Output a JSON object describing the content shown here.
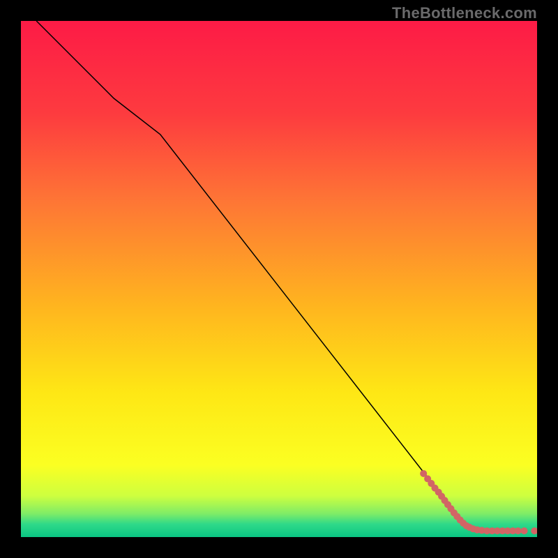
{
  "attribution": "TheBottleneck.com",
  "chart_data": {
    "type": "line",
    "title": "",
    "xlabel": "",
    "ylabel": "",
    "xlim": [
      0,
      100
    ],
    "ylim": [
      0,
      100
    ],
    "grid": false,
    "legend": false,
    "background_gradient_stops": [
      {
        "offset": 0.0,
        "color": "#fd1b46"
      },
      {
        "offset": 0.18,
        "color": "#fd3b3f"
      },
      {
        "offset": 0.35,
        "color": "#fe7635"
      },
      {
        "offset": 0.55,
        "color": "#ffb41f"
      },
      {
        "offset": 0.72,
        "color": "#fee715"
      },
      {
        "offset": 0.86,
        "color": "#fbff22"
      },
      {
        "offset": 0.92,
        "color": "#ceff3f"
      },
      {
        "offset": 0.955,
        "color": "#7eec67"
      },
      {
        "offset": 0.975,
        "color": "#2fd989"
      },
      {
        "offset": 1.0,
        "color": "#0ac683"
      }
    ],
    "series": [
      {
        "name": "curve",
        "type": "line",
        "color": "#000000",
        "width": 1.5,
        "points": [
          {
            "x": 3.0,
            "y": 100.0
          },
          {
            "x": 18.0,
            "y": 85.0
          },
          {
            "x": 27.0,
            "y": 78.0
          },
          {
            "x": 80.0,
            "y": 10.0
          },
          {
            "x": 84.0,
            "y": 4.5
          },
          {
            "x": 87.0,
            "y": 2.0
          }
        ]
      },
      {
        "name": "dots",
        "type": "scatter",
        "color": "#d16565",
        "radius": 5,
        "points": [
          {
            "x": 78.0,
            "y": 12.3
          },
          {
            "x": 78.8,
            "y": 11.3
          },
          {
            "x": 79.5,
            "y": 10.4
          },
          {
            "x": 80.2,
            "y": 9.5
          },
          {
            "x": 80.9,
            "y": 8.7
          },
          {
            "x": 81.5,
            "y": 7.9
          },
          {
            "x": 82.1,
            "y": 7.1
          },
          {
            "x": 82.7,
            "y": 6.3
          },
          {
            "x": 83.3,
            "y": 5.5
          },
          {
            "x": 83.9,
            "y": 4.7
          },
          {
            "x": 84.5,
            "y": 4.0
          },
          {
            "x": 85.1,
            "y": 3.3
          },
          {
            "x": 85.7,
            "y": 2.7
          },
          {
            "x": 86.3,
            "y": 2.2
          },
          {
            "x": 86.9,
            "y": 1.9
          },
          {
            "x": 87.6,
            "y": 1.6
          },
          {
            "x": 88.4,
            "y": 1.4
          },
          {
            "x": 89.3,
            "y": 1.3
          },
          {
            "x": 90.3,
            "y": 1.2
          },
          {
            "x": 91.3,
            "y": 1.2
          },
          {
            "x": 92.3,
            "y": 1.2
          },
          {
            "x": 93.3,
            "y": 1.2
          },
          {
            "x": 94.3,
            "y": 1.2
          },
          {
            "x": 95.3,
            "y": 1.2
          },
          {
            "x": 96.3,
            "y": 1.2
          },
          {
            "x": 97.5,
            "y": 1.2
          },
          {
            "x": 99.5,
            "y": 1.2
          }
        ]
      }
    ]
  }
}
